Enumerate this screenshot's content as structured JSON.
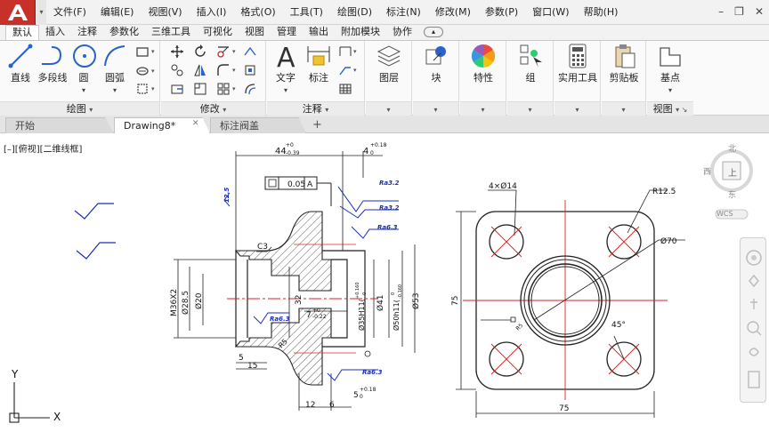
{
  "menubar": {
    "items": [
      "文件(F)",
      "编辑(E)",
      "视图(V)",
      "插入(I)",
      "格式(O)",
      "工具(T)",
      "绘图(D)",
      "标注(N)",
      "修改(M)",
      "参数(P)",
      "窗口(W)",
      "帮助(H)"
    ],
    "window_controls": [
      "–",
      "❐",
      "✕"
    ]
  },
  "ribbon_tabs": [
    "默认",
    "插入",
    "注释",
    "参数化",
    "三维工具",
    "可视化",
    "视图",
    "管理",
    "输出",
    "附加模块",
    "协作"
  ],
  "ribbon": {
    "draw_panel": {
      "title": "绘图",
      "tools": [
        "直线",
        "多段线",
        "圆",
        "圆弧"
      ]
    },
    "modify_panel": {
      "title": "修改"
    },
    "annotation_panel": {
      "title": "注释",
      "tools": [
        "文字",
        "标注"
      ]
    },
    "layers": "图层",
    "block": "块",
    "properties": "特性",
    "groups": "组",
    "utilities": "实用工具",
    "clipboard": "剪贴板",
    "view_panel": {
      "tool": "基点",
      "title": "视图"
    }
  },
  "file_tabs": [
    "开始",
    "Drawing8*",
    "标注阀盖"
  ],
  "file_tab_close": "✕",
  "file_tab_add": "+",
  "view_label": "[–][俯视][二维线框]",
  "viewcube": {
    "north": "北",
    "west": "西",
    "top": "上",
    "south": "东",
    "wcs": "WCS"
  },
  "ucs": {
    "x": "X",
    "y": "Y"
  },
  "drawing": {
    "dim_44": "44",
    "dim_44_tol_upper": "+0",
    "dim_44_tol_lower": "-0.39",
    "dim_4": "4",
    "dim_4_tol_upper": "+0.18",
    "dim_4_tol_lower": "0",
    "tolerance_frame": "0.05",
    "datum": "A",
    "roughness_125": "12.5",
    "roughness_a": "Ra3.2",
    "roughness_b": "Ra3.2",
    "roughness_c": "Ra6.3",
    "roughness_d": "Ra6.3",
    "roughness_e": "Ra6.3",
    "chamfer": "C3",
    "thread": "M36X2",
    "dia_285": "Ø28.5",
    "dia_20": "Ø20",
    "dim_32": "32",
    "dim_7": "7",
    "dim_7_tol_upper": "+0",
    "dim_7_tol_lower": "-0.22",
    "dia_35": "Ø35H11(",
    "dia_35_tol_upper": "+0.160",
    "dia_35_tol_lower": "0",
    "dia_41": "Ø41",
    "dia_50": "Ø50h11(",
    "dia_50_tol_upper": "0",
    "dia_50_tol_lower": "-0.160",
    "dia_53": "Ø53",
    "dim_5": "5",
    "dim_15": "15",
    "dim_12": "12",
    "dim_6": "6",
    "dim_5b": "5",
    "dim_5b_tol_upper": "+0.18",
    "dim_5b_tol_lower": "0",
    "dim_r5": "R5",
    "holes": "4×Ø14",
    "r125": "R12.5",
    "dia_70": "Ø70",
    "dim_75_v": "75",
    "dim_75_h": "75",
    "angle": "45°",
    "r5_small": "R5",
    "datum_a": "A"
  }
}
